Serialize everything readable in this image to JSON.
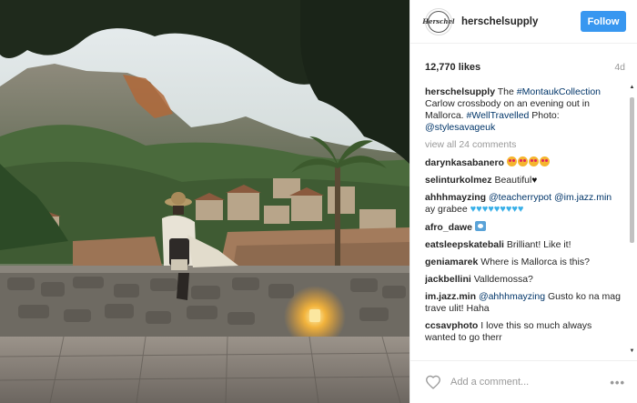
{
  "photo": {
    "alt": "Woman in hat sitting on a stone wall overlooking Mallorca village and mountains"
  },
  "header": {
    "avatar_text": "Herschel",
    "username": "herschelsupply",
    "follow_label": "Follow"
  },
  "stats": {
    "likes": "12,770 likes",
    "age": "4d"
  },
  "caption": {
    "user": "herschelsupply",
    "t1": " The ",
    "tag1": "#MontaukCollection",
    "t2": " Carlow crossbody on an evening out in Mallorca. ",
    "tag2": "#WellTravelled",
    "t3": " Photo: ",
    "tag3": "@stylesavageuk"
  },
  "view_all": "view all 24 comments",
  "comments": [
    {
      "user": "darynkasabanero",
      "text": ""
    },
    {
      "user": "selinturkolmez",
      "text": "Beautiful"
    },
    {
      "user": "ahhhmayzing",
      "mention": "@teacherrypot",
      "mention2": "@im.jazz.min",
      "text": " ay grabee "
    },
    {
      "user": "afro_dawe",
      "text": ""
    },
    {
      "user": "eatsleepskatebali",
      "text": "Brilliant! Like it!"
    },
    {
      "user": "geniamarek",
      "text": "Where is Mallorca is this?"
    },
    {
      "user": "jackbellini",
      "text": "Valldemossa?"
    },
    {
      "user": "im.jazz.min",
      "mention": "@ahhhmayzing",
      "text": " Gusto ko na mag trave ulit! Haha"
    },
    {
      "user": "ccsavphoto",
      "text": "I love this so much always wanted to go therr"
    }
  ],
  "footer": {
    "placeholder": "Add a comment...",
    "more": "•••"
  },
  "colors": {
    "follow": "#3897f0",
    "link": "#003569",
    "muted": "#999999"
  }
}
